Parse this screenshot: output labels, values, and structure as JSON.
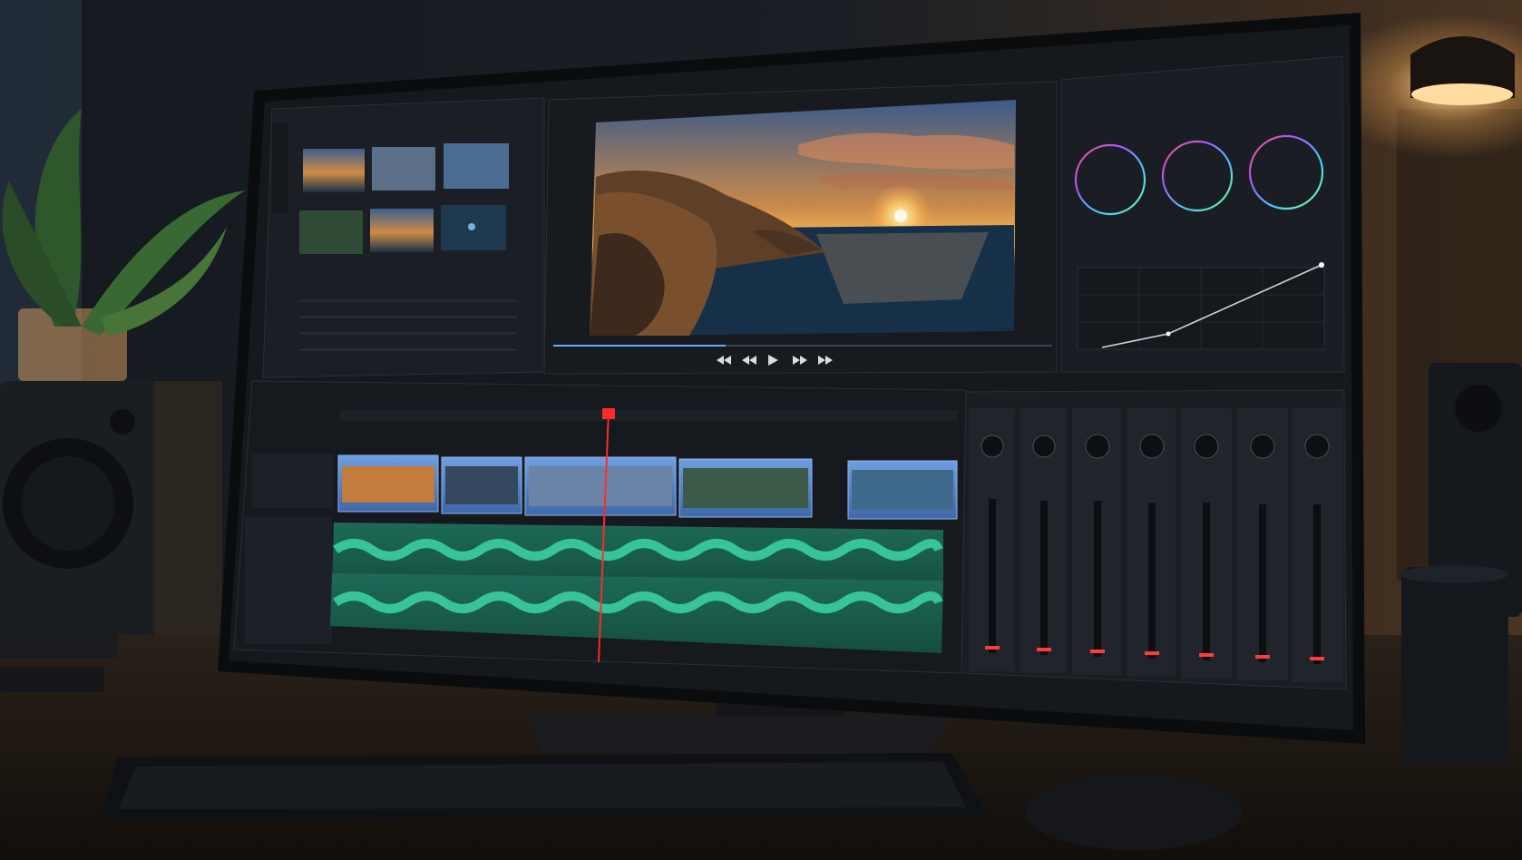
{
  "scene": {
    "description_kind": "photo",
    "colors": {
      "room_bg": "#1a1d22",
      "wall_warm": "#3a2a1c",
      "desk": "#221c16",
      "monitor_bezel": "#0b0c0e",
      "ui_bg": "#15181d",
      "ui_panel": "#1b1f25",
      "ui_border": "#2a2f37",
      "clip_video": "#4f7fc6",
      "clip_audio": "#1f6a58",
      "waveform": "#38d0a0",
      "playhead": "#ff2a2a",
      "meter_red": "#ff3b3b",
      "lamp_glow": "#ffcf8a"
    },
    "color_wheels": [
      "wheel-1",
      "wheel-2",
      "wheel-3"
    ],
    "media_thumbnails": 6,
    "timeline_video_clips": 5,
    "audio_tracks": 2,
    "mixer_channels": 7
  }
}
